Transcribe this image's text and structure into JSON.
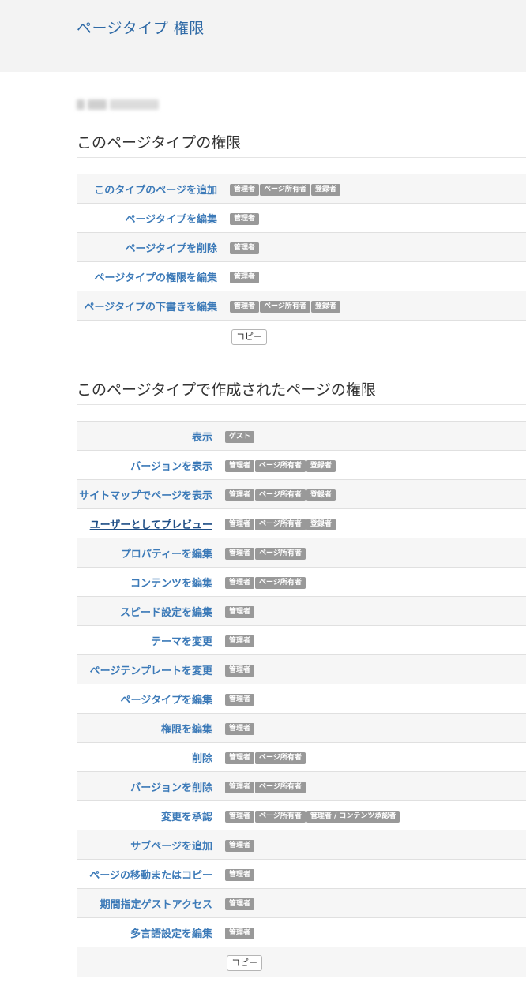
{
  "header": {
    "title": "ページタイプ 権限"
  },
  "section1": {
    "title": "このページタイプの権限",
    "rows": [
      {
        "label": "このタイプのページを追加",
        "badges": [
          "管理者",
          "ページ所有者",
          "登録者"
        ]
      },
      {
        "label": "ページタイプを編集",
        "badges": [
          "管理者"
        ]
      },
      {
        "label": "ページタイプを削除",
        "badges": [
          "管理者"
        ]
      },
      {
        "label": "ページタイプの権限を編集",
        "badges": [
          "管理者"
        ]
      },
      {
        "label": "ページタイプの下書きを編集",
        "badges": [
          "管理者",
          "ページ所有者",
          "登録者"
        ]
      }
    ],
    "copy_label": "コピー"
  },
  "section2": {
    "title": "このページタイプで作成されたページの権限",
    "rows": [
      {
        "label": "表示",
        "badges": [
          "ゲスト"
        ]
      },
      {
        "label": "バージョンを表示",
        "badges": [
          "管理者",
          "ページ所有者",
          "登録者"
        ]
      },
      {
        "label": "サイトマップでページを表示",
        "badges": [
          "管理者",
          "ページ所有者",
          "登録者"
        ]
      },
      {
        "label": "ユーザーとしてプレビュー",
        "badges": [
          "管理者",
          "ページ所有者",
          "登録者"
        ],
        "link": true
      },
      {
        "label": "プロパティーを編集",
        "badges": [
          "管理者",
          "ページ所有者"
        ]
      },
      {
        "label": "コンテンツを編集",
        "badges": [
          "管理者",
          "ページ所有者"
        ]
      },
      {
        "label": "スピード設定を編集",
        "badges": [
          "管理者"
        ]
      },
      {
        "label": "テーマを変更",
        "badges": [
          "管理者"
        ]
      },
      {
        "label": "ページテンプレートを変更",
        "badges": [
          "管理者"
        ]
      },
      {
        "label": "ページタイプを編集",
        "badges": [
          "管理者"
        ]
      },
      {
        "label": "権限を編集",
        "badges": [
          "管理者"
        ]
      },
      {
        "label": "削除",
        "badges": [
          "管理者",
          "ページ所有者"
        ]
      },
      {
        "label": "バージョンを削除",
        "badges": [
          "管理者",
          "ページ所有者"
        ]
      },
      {
        "label": "変更を承認",
        "badges": [
          "管理者",
          "ページ所有者",
          "管理者 / コンテンツ承認者"
        ]
      },
      {
        "label": "サブページを追加",
        "badges": [
          "管理者"
        ]
      },
      {
        "label": "ページの移動またはコピー",
        "badges": [
          "管理者"
        ]
      },
      {
        "label": "期間指定ゲストアクセス",
        "badges": [
          "管理者"
        ]
      },
      {
        "label": "多言語設定を編集",
        "badges": [
          "管理者"
        ]
      }
    ],
    "copy_label": "コピー"
  }
}
